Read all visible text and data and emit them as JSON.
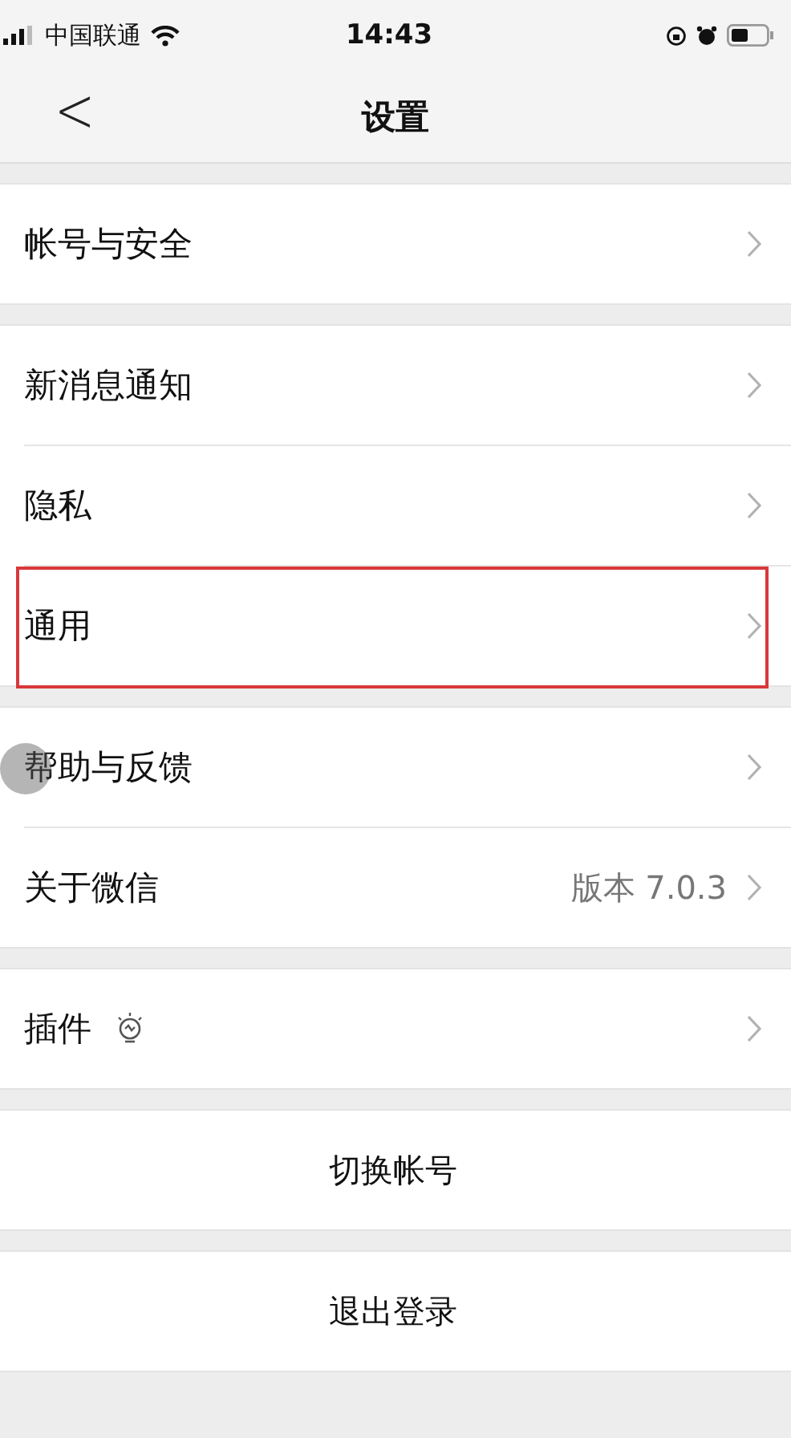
{
  "status_bar": {
    "carrier": "中国联通",
    "time": "14:43"
  },
  "nav": {
    "back": "<",
    "title": "设置"
  },
  "groups": [
    {
      "items": [
        {
          "kind": "nav",
          "label": "帐号与安全",
          "highlighted": false
        }
      ]
    },
    {
      "items": [
        {
          "kind": "nav",
          "label": "新消息通知",
          "highlighted": false
        },
        {
          "kind": "nav",
          "label": "隐私",
          "highlighted": false
        },
        {
          "kind": "nav",
          "label": "通用",
          "highlighted": true
        }
      ]
    },
    {
      "items": [
        {
          "kind": "nav",
          "label": "帮助与反馈",
          "highlighted": false,
          "touch_indicator": true
        },
        {
          "kind": "nav",
          "label": "关于微信",
          "value": "版本 7.0.3",
          "highlighted": false
        }
      ]
    },
    {
      "items": [
        {
          "kind": "plugin",
          "label": "插件",
          "highlighted": false
        }
      ]
    },
    {
      "items": [
        {
          "kind": "action",
          "label": "切换帐号",
          "highlighted": false
        }
      ]
    },
    {
      "items": [
        {
          "kind": "action",
          "label": "退出登录",
          "highlighted": false
        }
      ]
    }
  ]
}
